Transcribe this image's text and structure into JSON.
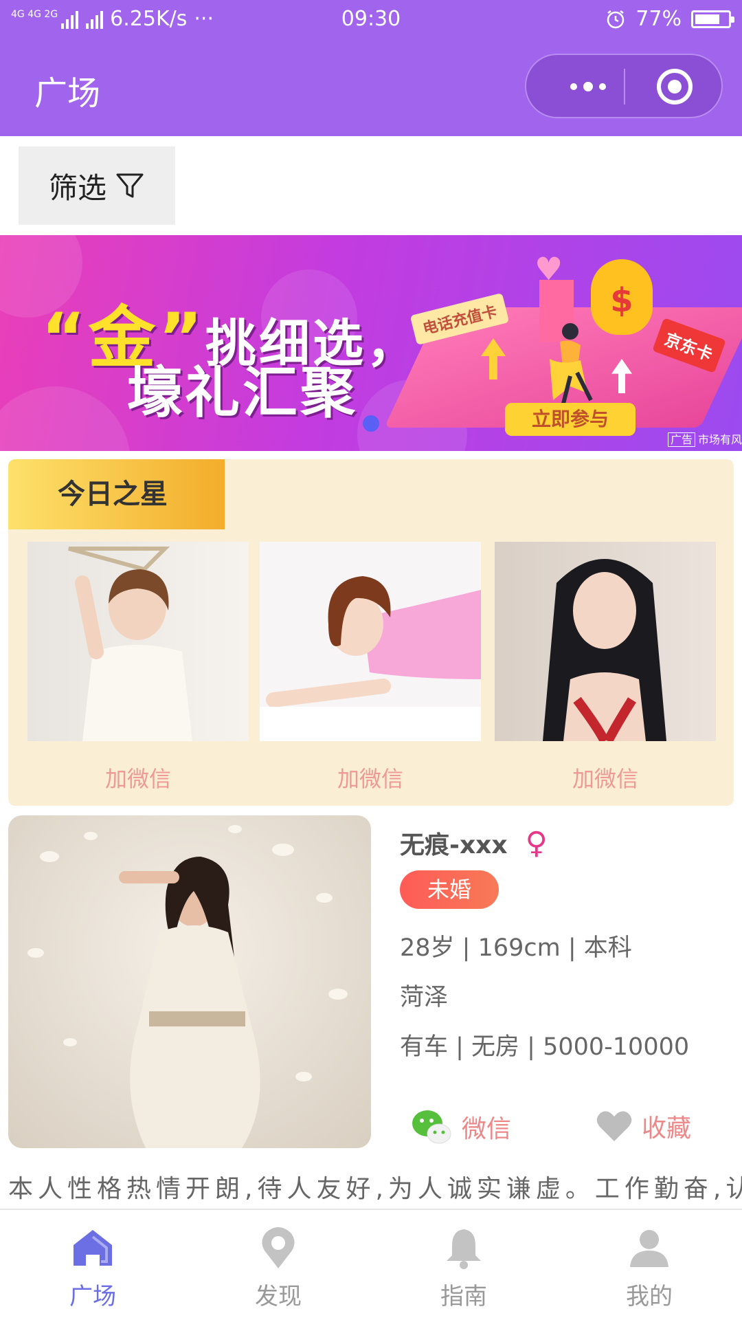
{
  "status_bar": {
    "network": "4G 4G 2G",
    "speed": "6.25K/s",
    "more": "···",
    "time": "09:30",
    "battery": "77%",
    "battery_level": 0.77
  },
  "navbar": {
    "title": "广场"
  },
  "filter": {
    "label": "筛选"
  },
  "banner": {
    "headline_gold": "“金”",
    "headline_rest": "挑细选，",
    "headline_line2": "壕礼汇聚",
    "tag_phone_card": "电话充值卡",
    "tag_jd_card": "京东卡",
    "money_symbol": "$",
    "join_button": "立即参与",
    "ad_badge": "广告",
    "ad_source": "市场有风"
  },
  "today_star": {
    "title": "今日之星",
    "cards": [
      {
        "action": "加微信"
      },
      {
        "action": "加微信"
      },
      {
        "action": "加微信"
      }
    ]
  },
  "profile": {
    "name": "无痕-xxx",
    "gender_symbol": "♀",
    "marital_status": "未婚",
    "basic": "28岁 | 169cm | 本科",
    "city": "菏泽",
    "assets": "有车 | 无房 | 5000-10000",
    "wechat_label": "微信",
    "favorite_label": "收藏",
    "bio": "本人性格热情开朗,待人友好,为人诚实谦虚。工作勤奋,认"
  },
  "tabbar": {
    "items": [
      {
        "label": "广场",
        "icon": "home-icon",
        "active": true
      },
      {
        "label": "发现",
        "icon": "location-pin-icon",
        "active": false
      },
      {
        "label": "指南",
        "icon": "bell-icon",
        "active": false
      },
      {
        "label": "我的",
        "icon": "user-icon",
        "active": false
      }
    ]
  },
  "colors": {
    "theme_purple": "#a064ed",
    "accent_pink": "#ee8888",
    "tab_active": "#6b6fe3"
  }
}
